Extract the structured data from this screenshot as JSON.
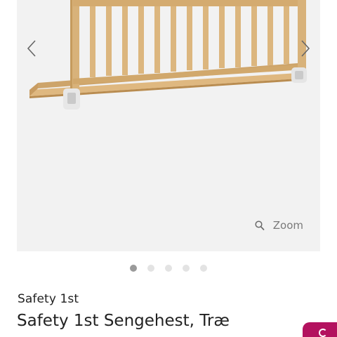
{
  "gallery": {
    "zoom_label": "Zoom",
    "slide_count": 5,
    "active_slide": 1,
    "background": "#f2f2f2"
  },
  "product": {
    "brand": "Safety 1st",
    "title": "Safety 1st Sengehest, Træ"
  },
  "colors": {
    "accent": "#b3125f",
    "dot_active": "#9a9a9a",
    "dot_inactive": "#e3e3e3"
  }
}
